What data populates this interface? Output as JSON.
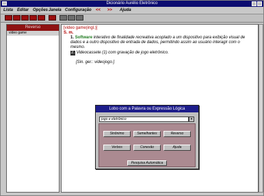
{
  "window": {
    "title": "Dicionário Aurélio Eletrônico"
  },
  "menu": {
    "items": [
      "Lista",
      "Editar",
      "Opções",
      "Janela",
      "Configuração"
    ],
    "nav_prev": "<<",
    "nav_next": ">>",
    "help": "Ajuda"
  },
  "toolbar": {
    "icon_names": [
      "pages-icon",
      "pages-icon",
      "pages-icon",
      "pages-icon",
      "pages-icon",
      "print-icon",
      "book-icon",
      "search-icon",
      "question-icon"
    ]
  },
  "left_pane": {
    "header": "Reverso",
    "items": [
      "video game"
    ]
  },
  "entry": {
    "headword": "[video game(ingl.)]",
    "pos": "S. m.",
    "sense_number": "1.",
    "domain": "Software",
    "definition": "interativo de finalidade recreativa acoplado a um dispositivo para exibição visual de dados e a outro dispositivo de entrada de dados, permitindo assim ao usuário interagir com o mesmo.",
    "sense2_tag": "2.",
    "sense2_text": "Videocassete (1) com gravação de jogo eletrônico.",
    "synonym": "[Sin. ger.: videojogo.]"
  },
  "dialog": {
    "title": "Lobo com a Palavra ou Expressão Lógica",
    "input_value": "jogo e eletrônico",
    "buttons": [
      "Sinônimo",
      "Semelhantes",
      "Reverso",
      "Verbos",
      "Conexão",
      "Ajuda"
    ],
    "wide_button": "Pesquisa Automática"
  }
}
